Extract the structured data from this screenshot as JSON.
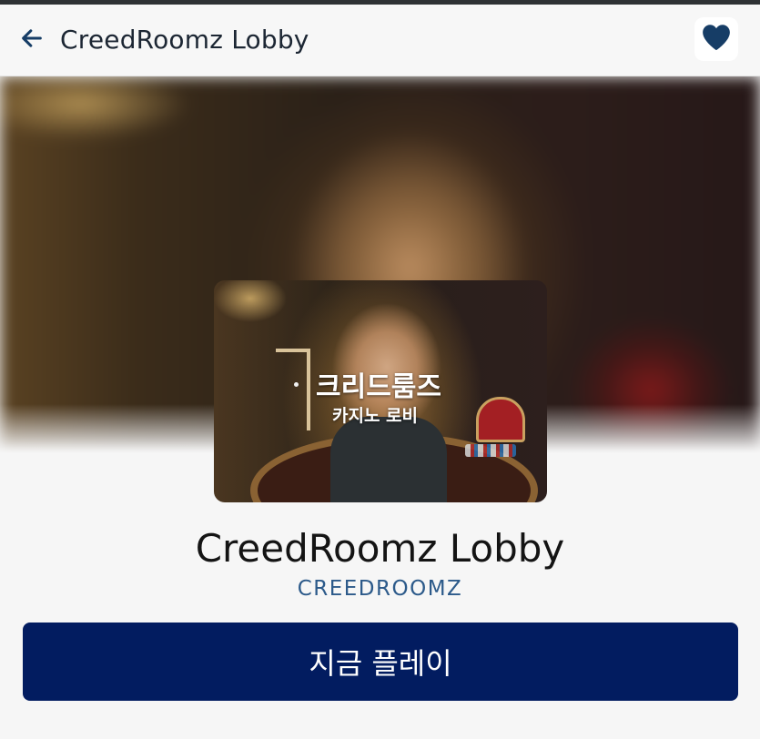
{
  "header": {
    "title": "CreedRoomz Lobby",
    "back_icon": "arrow-left-icon",
    "favorite_icon": "heart-icon"
  },
  "thumbnail": {
    "logo_main": "크리드룸즈",
    "logo_sub": "카지노 로비"
  },
  "game": {
    "title": "CreedRoomz Lobby",
    "provider": "CREEDROOMZ"
  },
  "play_button": {
    "label": "지금 플레이"
  },
  "colors": {
    "accent": "#021c60",
    "provider_text": "#2c5a8a",
    "icon": "#163d66"
  }
}
